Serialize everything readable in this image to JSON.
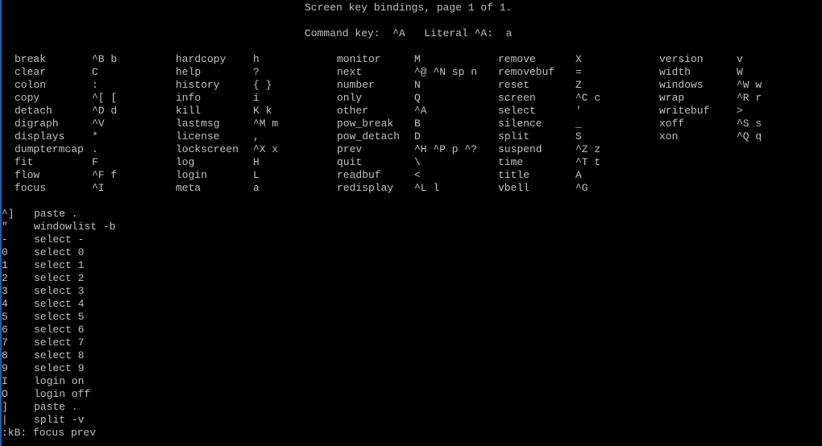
{
  "header": {
    "title": "Screen key bindings, page 1 of 1.",
    "command_key": "Command key:  ^A   Literal ^A:  a"
  },
  "bindings": [
    [
      [
        "break",
        "^B b"
      ],
      [
        "clear",
        "C"
      ],
      [
        "colon",
        ":"
      ],
      [
        "copy",
        "^[ ["
      ],
      [
        "detach",
        "^D d"
      ],
      [
        "digraph",
        "^V"
      ],
      [
        "displays",
        "*"
      ],
      [
        "dumptermcap",
        "."
      ],
      [
        "fit",
        "F"
      ],
      [
        "flow",
        "^F f"
      ],
      [
        "focus",
        "^I"
      ]
    ],
    [
      [
        "hardcopy",
        "h"
      ],
      [
        "help",
        "?"
      ],
      [
        "history",
        "{ }"
      ],
      [
        "info",
        "i"
      ],
      [
        "kill",
        "K k"
      ],
      [
        "lastmsg",
        "^M m"
      ],
      [
        "license",
        ","
      ],
      [
        "lockscreen",
        "^X x"
      ],
      [
        "log",
        "H"
      ],
      [
        "login",
        "L"
      ],
      [
        "meta",
        "a"
      ]
    ],
    [
      [
        "monitor",
        "M"
      ],
      [
        "next",
        "^@ ^N sp n"
      ],
      [
        "number",
        "N"
      ],
      [
        "only",
        "Q"
      ],
      [
        "other",
        "^A"
      ],
      [
        "pow_break",
        "B"
      ],
      [
        "pow_detach",
        "D"
      ],
      [
        "prev",
        "^H ^P p ^?"
      ],
      [
        "quit",
        "\\"
      ],
      [
        "readbuf",
        "<"
      ],
      [
        "redisplay",
        "^L l"
      ]
    ],
    [
      [
        "remove",
        "X"
      ],
      [
        "removebuf",
        "="
      ],
      [
        "reset",
        "Z"
      ],
      [
        "screen",
        "^C c"
      ],
      [
        "select",
        "'"
      ],
      [
        "silence",
        "_"
      ],
      [
        "split",
        "S"
      ],
      [
        "suspend",
        "^Z z"
      ],
      [
        "time",
        "^T t"
      ],
      [
        "title",
        "A"
      ],
      [
        "vbell",
        "^G"
      ]
    ],
    [
      [
        "version",
        "v"
      ],
      [
        "width",
        "W"
      ],
      [
        "windows",
        "^W w"
      ],
      [
        "wrap",
        "^R r"
      ],
      [
        "writebuf",
        ">"
      ],
      [
        "xoff",
        "^S s"
      ],
      [
        "xon",
        "^Q q"
      ]
    ]
  ],
  "extra_bindings": [
    [
      "^]",
      "paste ."
    ],
    [
      "\"",
      "windowlist -b"
    ],
    [
      "-",
      "select -"
    ],
    [
      "0",
      "select 0"
    ],
    [
      "1",
      "select 1"
    ],
    [
      "2",
      "select 2"
    ],
    [
      "3",
      "select 3"
    ],
    [
      "4",
      "select 4"
    ],
    [
      "5",
      "select 5"
    ],
    [
      "6",
      "select 6"
    ],
    [
      "7",
      "select 7"
    ],
    [
      "8",
      "select 8"
    ],
    [
      "9",
      "select 9"
    ],
    [
      "I",
      "login on"
    ],
    [
      "O",
      "login off"
    ],
    [
      "]",
      "paste ."
    ],
    [
      "|",
      "split -v"
    ]
  ],
  "footer": ":kB: focus prev"
}
